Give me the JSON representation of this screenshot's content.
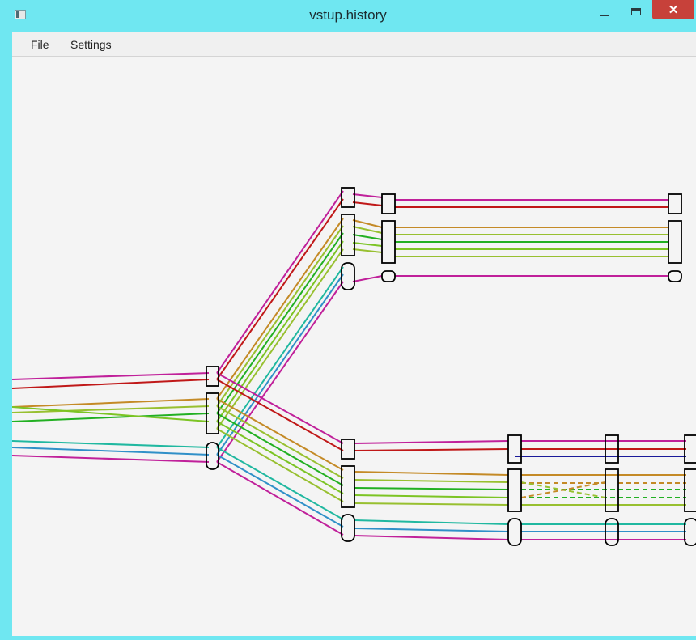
{
  "window": {
    "title": "vstup.history"
  },
  "menu": {
    "file": "File",
    "settings": "Settings"
  },
  "colors": {
    "magenta": "#c0209a",
    "red": "#c01818",
    "orange": "#c48a26",
    "yellow_green": "#98c030",
    "green": "#22b022",
    "lime": "#7cc424",
    "teal": "#20b8a0",
    "blue": "#3090c8",
    "navy": "#1a1a9a"
  }
}
